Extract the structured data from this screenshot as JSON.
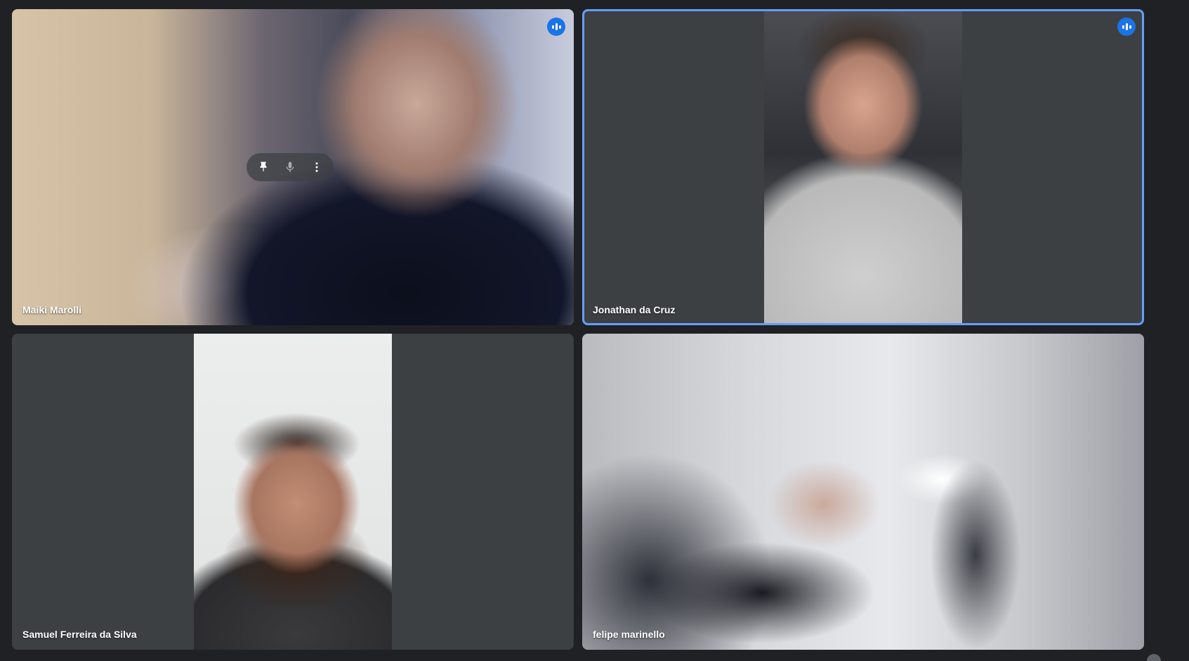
{
  "participants": [
    {
      "name": "Maiki Marolli",
      "speaking": true
    },
    {
      "name": "Jonathan da Cruz",
      "speaking": true,
      "active": true
    },
    {
      "name": "Samuel Ferreira da Silva"
    },
    {
      "name": "felipe marinello"
    }
  ],
  "tile_controls": [
    "pin-icon",
    "microphone-icon",
    "more-vert-icon"
  ],
  "colors": {
    "page_background": "#202124",
    "tile_background": "#3c4043",
    "active_border": "#669df6",
    "speaking_badge": "#1a73e8"
  }
}
